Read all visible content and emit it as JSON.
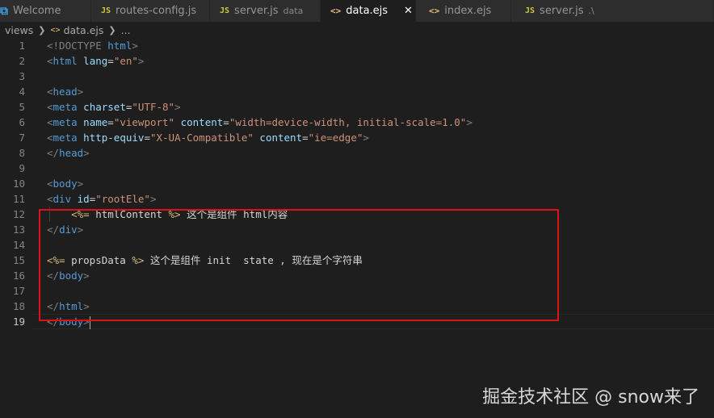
{
  "tabs": [
    {
      "label": "Welcome",
      "icon": "vscode-icon",
      "active": false
    },
    {
      "label": "routes-config.js",
      "icon": "js-file-icon",
      "active": false
    },
    {
      "label": "server.js",
      "icon": "js-file-icon",
      "desc": "data",
      "active": false
    },
    {
      "label": "data.ejs",
      "icon": "ejs-file-icon",
      "active": true
    },
    {
      "label": "index.ejs",
      "icon": "ejs-file-icon",
      "active": false
    },
    {
      "label": "server.js",
      "icon": "js-file-icon",
      "desc": ".\\",
      "active": false
    }
  ],
  "tab_icon_glyphs": {
    "js": "JS",
    "ejs": "<>",
    "close": "✕"
  },
  "breadcrumb": {
    "folder": "views",
    "file": "data.ejs",
    "more": "..."
  },
  "line_numbers": [
    "1",
    "2",
    "3",
    "4",
    "5",
    "6",
    "7",
    "8",
    "9",
    "10",
    "11",
    "12",
    "13",
    "14",
    "15",
    "16",
    "17",
    "18",
    "19"
  ],
  "current_line": "19",
  "code": {
    "l1": {
      "a": "<!DOCTYPE",
      "b": " html",
      "c": ">"
    },
    "l2": {
      "a": "<",
      "b": "html",
      "c": " lang",
      "d": "=",
      "e": "\"en\"",
      "f": ">"
    },
    "l4": {
      "a": "<",
      "b": "head",
      "c": ">"
    },
    "l5": {
      "a": "<",
      "b": "meta",
      "c": " charset",
      "d": "=",
      "e": "\"UTF-8\"",
      "f": ">"
    },
    "l6": {
      "a": "<",
      "b": "meta",
      "c": " name",
      "d": "=",
      "e": "\"viewport\"",
      "f": " content",
      "g": "=",
      "h": "\"width=device-width, initial-scale=1.0\"",
      "i": ">"
    },
    "l7": {
      "a": "<",
      "b": "meta",
      "c": " http-equiv",
      "d": "=",
      "e": "\"X-UA-Compatible\"",
      "f": " content",
      "g": "=",
      "h": "\"ie=edge\"",
      "i": ">"
    },
    "l8": {
      "a": "</",
      "b": "head",
      "c": ">"
    },
    "l10": {
      "a": "<",
      "b": "body",
      "c": ">"
    },
    "l11": {
      "a": "<",
      "b": "div",
      "c": " id",
      "d": "=",
      "e": "\"rootEle\"",
      "f": ">"
    },
    "l12": {
      "a": "    ",
      "b": "<%=",
      "c": " htmlContent ",
      "d": "%>",
      "e": " 这个是组件 html内容"
    },
    "l13": {
      "a": "</",
      "b": "div",
      "c": ">"
    },
    "l15": {
      "a": "<%=",
      "b": " propsData ",
      "c": "%>",
      "d": " 这个是组件 init  state , 现在是个字符串"
    },
    "l16": {
      "a": "</",
      "b": "body",
      "c": ">"
    },
    "l18": {
      "a": "</",
      "b": "html",
      "c": ">"
    },
    "l19": {
      "a": "</",
      "b": "body",
      "c": ">"
    }
  },
  "watermark": "掘金技术社区 @ snow来了",
  "colors": {
    "editor_bg": "#1e1e1e",
    "tag": "#569cd6",
    "attr": "#9cdcfe",
    "string": "#ce9178",
    "highlight_box": "#e0101a"
  }
}
